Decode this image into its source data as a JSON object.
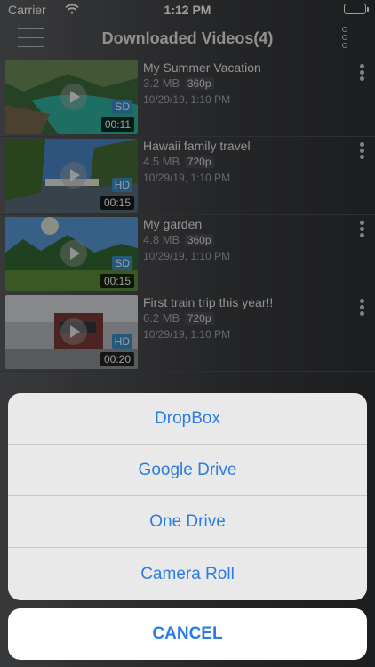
{
  "status_bar": {
    "carrier": "Carrier",
    "time": "1:12 PM"
  },
  "nav": {
    "title": "Downloaded Videos(4)"
  },
  "videos": [
    {
      "title": "My Summer Vacation",
      "size": "3.2 MB",
      "resolution": "360p",
      "date": "10/29/19, 1:10 PM",
      "quality": "SD",
      "duration": "00:11"
    },
    {
      "title": "Hawaii family travel",
      "size": "4.5 MB",
      "resolution": "720p",
      "date": "10/29/19, 1:10 PM",
      "quality": "HD",
      "duration": "00:15"
    },
    {
      "title": "My garden",
      "size": "4.8 MB",
      "resolution": "360p",
      "date": "10/29/19, 1:10 PM",
      "quality": "SD",
      "duration": "00:15"
    },
    {
      "title": "First train trip this year!!",
      "size": "6.2 MB",
      "resolution": "720p",
      "date": "10/29/19, 1:10 PM",
      "quality": "HD",
      "duration": "00:20"
    }
  ],
  "action_sheet": {
    "options": [
      "DropBox",
      "Google Drive",
      "One Drive",
      "Camera Roll"
    ],
    "cancel": "CANCEL"
  },
  "colors": {
    "accent": "#2b7de1",
    "badge": "#3a8fc9"
  }
}
